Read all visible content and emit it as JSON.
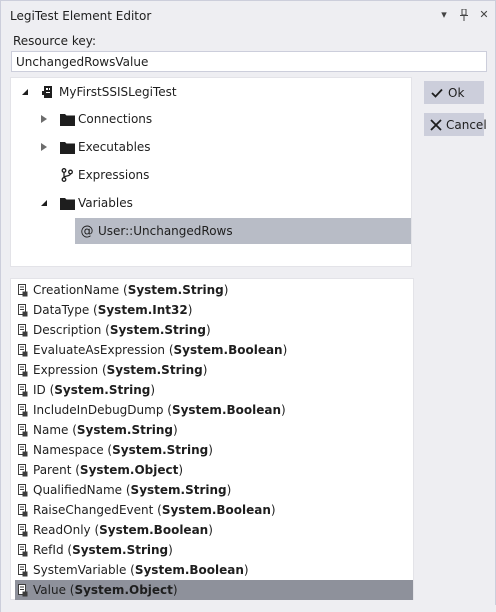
{
  "window": {
    "title": "LegiTest Element Editor",
    "title_buttons": [
      "▾",
      "⊥",
      "✕"
    ]
  },
  "resource_key": {
    "label": "Resource key:",
    "value": "UnchangedRowsValue"
  },
  "tree": {
    "root": "MyFirstSSISLegiTest",
    "items": [
      {
        "label": "Connections"
      },
      {
        "label": "Executables"
      },
      {
        "label": "Expressions"
      },
      {
        "label": "Variables"
      },
      {
        "label": "User::UnchangedRows",
        "prefix": "@"
      }
    ]
  },
  "buttons": {
    "ok": "Ok",
    "cancel": "Cancel"
  },
  "properties": [
    {
      "name": "CreationName",
      "type": "System.String"
    },
    {
      "name": "DataType",
      "type": "System.Int32"
    },
    {
      "name": "Description",
      "type": "System.String"
    },
    {
      "name": "EvaluateAsExpression",
      "type": "System.Boolean"
    },
    {
      "name": "Expression",
      "type": "System.String"
    },
    {
      "name": "ID",
      "type": "System.String"
    },
    {
      "name": "IncludeInDebugDump",
      "type": "System.Boolean"
    },
    {
      "name": "Name",
      "type": "System.String"
    },
    {
      "name": "Namespace",
      "type": "System.String"
    },
    {
      "name": "Parent",
      "type": "System.Object"
    },
    {
      "name": "QualifiedName",
      "type": "System.String"
    },
    {
      "name": "RaiseChangedEvent",
      "type": "System.Boolean"
    },
    {
      "name": "ReadOnly",
      "type": "System.Boolean"
    },
    {
      "name": "RefId",
      "type": "System.String"
    },
    {
      "name": "SystemVariable",
      "type": "System.Boolean"
    },
    {
      "name": "Value",
      "type": "System.Object",
      "selected": true
    }
  ],
  "colors": {
    "window_bg": "#eeeef2",
    "selection_tree": "#b8bcc6",
    "selection_list": "#8e919b",
    "button_bg": "#cccedb"
  }
}
